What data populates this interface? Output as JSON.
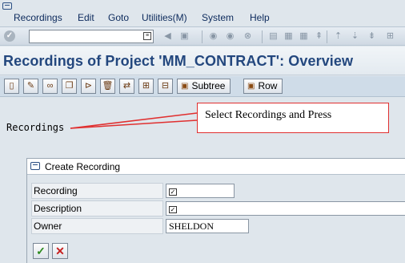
{
  "menubar": {
    "items": [
      "Recordings",
      "Edit",
      "Goto",
      "Utilities(M)",
      "System",
      "Help"
    ]
  },
  "toolbar": {
    "command_field_value": ""
  },
  "page": {
    "title": "Recordings of Project 'MM_CONTRACT': Overview"
  },
  "app_toolbar": {
    "subtree_label": "Subtree",
    "row_label": "Row"
  },
  "content": {
    "recordings_label": "Recordings"
  },
  "callout": {
    "text": "Select Recordings and Press"
  },
  "dialog": {
    "title": "Create Recording",
    "fields": [
      {
        "label": "Recording",
        "value": ""
      },
      {
        "label": "Description",
        "value": ""
      },
      {
        "label": "Owner",
        "value": "SHELDON"
      }
    ]
  },
  "colors": {
    "title": "#23477e",
    "menu_text": "#0c2a5c",
    "callout_border": "#e03030",
    "confirm": "#2c8a1e",
    "cancel": "#c62020"
  }
}
